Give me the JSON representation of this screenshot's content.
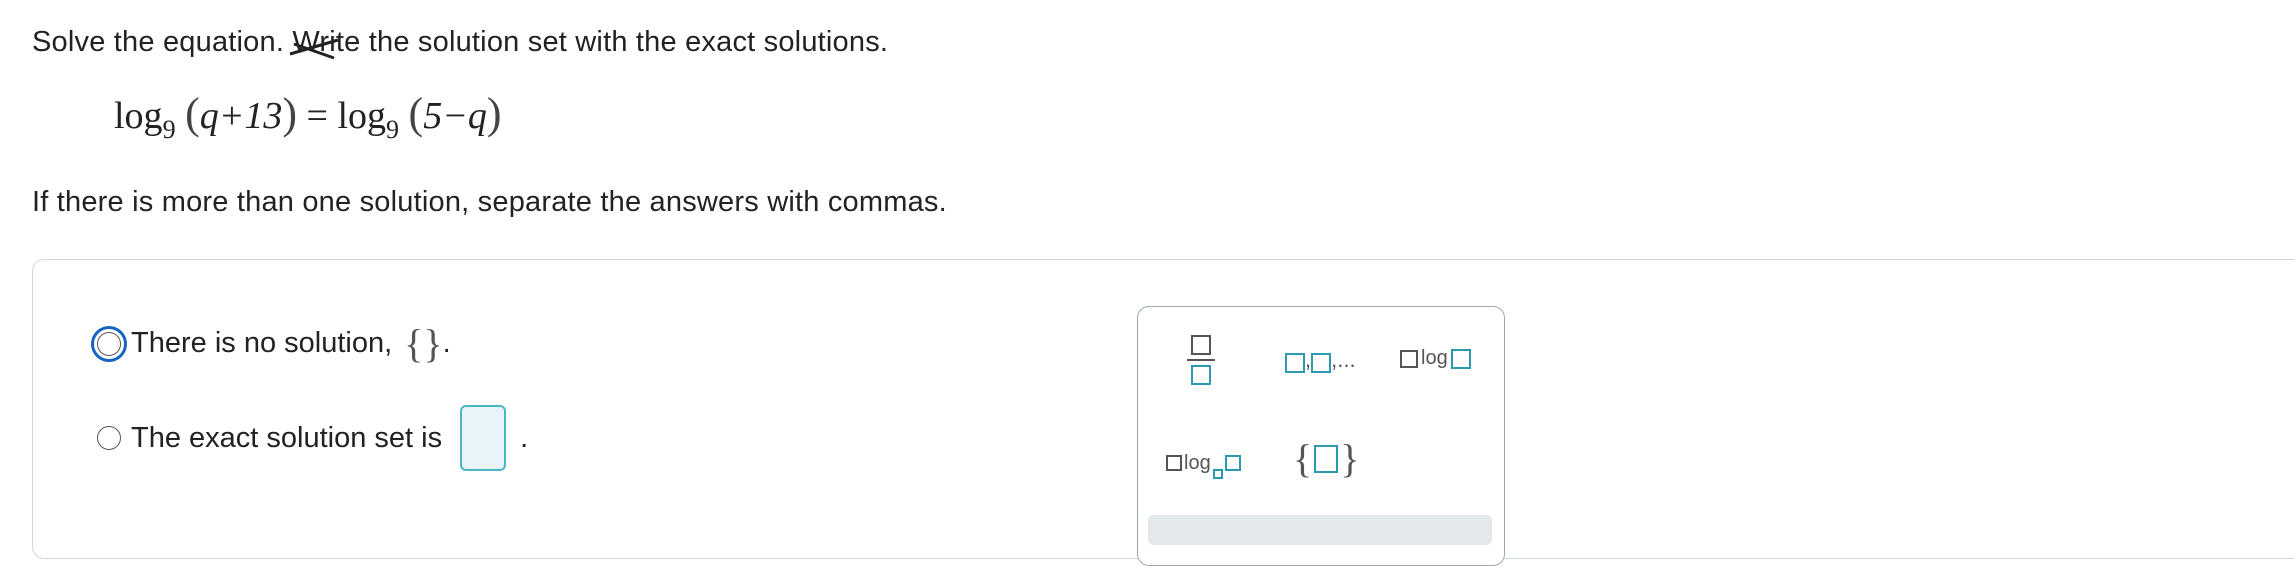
{
  "prompt": {
    "before": "Solve the equation. ",
    "struck_word": "Write",
    "after": " the solution set with the exact solutions."
  },
  "equation": {
    "log": "log",
    "base": "9",
    "left_arg": "q+13",
    "equals": "=",
    "right_arg": "5−q"
  },
  "hint": "If there is more than one solution, separate the answers with commas.",
  "options": {
    "no_solution_label": "There is no solution,",
    "no_solution_braces": "{}",
    "no_solution_period": ".",
    "exact_set_label": "The exact solution set is",
    "exact_set_period": "."
  },
  "palette": {
    "list_suffix": ",...",
    "log_label": "log",
    "logb_label": "log",
    "set_open": "{",
    "set_close": "}"
  }
}
